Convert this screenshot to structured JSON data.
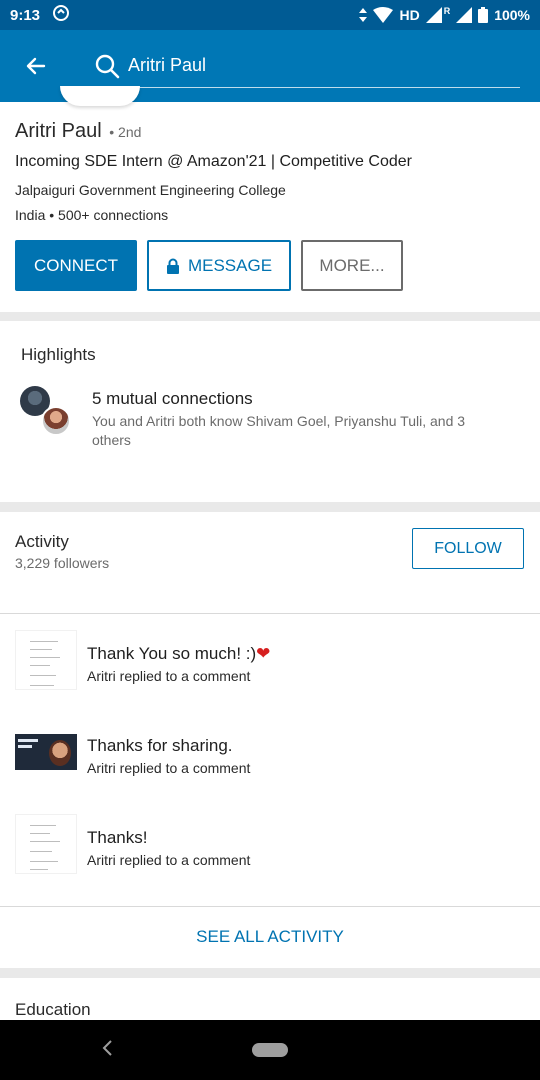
{
  "status_bar": {
    "time": "9:13",
    "battery": "100%",
    "network_label": "HD",
    "roaming": "R",
    "icons": [
      "sync-icon",
      "wifi-icon",
      "signal-icon",
      "battery-icon"
    ]
  },
  "app_bar": {
    "search_value": "Aritri Paul"
  },
  "profile": {
    "name": "Aritri Paul",
    "degree": "• 2nd",
    "headline": "Incoming SDE Intern @ Amazon'21 | Competitive Coder",
    "school": "Jalpaiguri Government  Engineering College",
    "location_connections": "India • 500+ connections",
    "connect_label": "CONNECT",
    "message_label": "MESSAGE",
    "more_label": "MORE..."
  },
  "highlights": {
    "title": "Highlights",
    "mutual_title": "5 mutual connections",
    "mutual_desc": "You and Aritri both know Shivam Goel, Priyanshu Tuli, and 3 others"
  },
  "activity": {
    "title": "Activity",
    "followers": "3,229 followers",
    "follow_label": "FOLLOW",
    "items": [
      {
        "title": "Thank You so much! :)",
        "subtitle": "Aritri replied to a comment",
        "emoji": "❤"
      },
      {
        "title": "Thanks for sharing.",
        "subtitle": "Aritri replied to a comment"
      },
      {
        "title": "Thanks!",
        "subtitle": "Aritri replied to a comment"
      }
    ],
    "see_all_label": "SEE ALL ACTIVITY"
  },
  "education": {
    "title": "Education"
  },
  "colors": {
    "primary": "#0077b5",
    "status_bar": "#005b94",
    "button": "#0073b1"
  }
}
